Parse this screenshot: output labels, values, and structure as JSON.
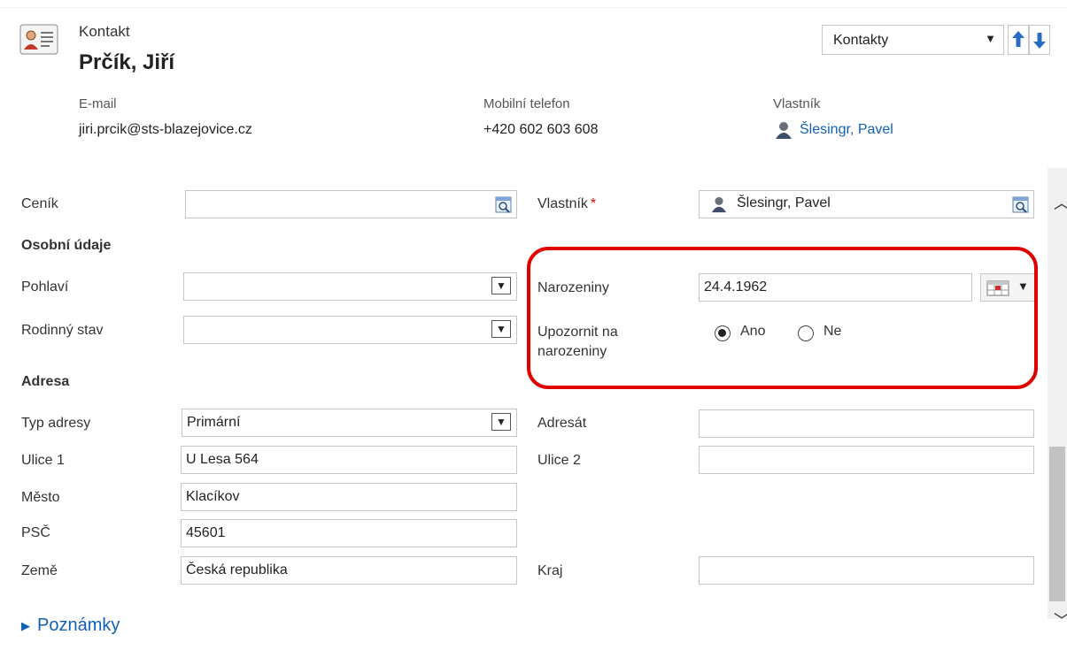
{
  "header": {
    "entity_type": "Kontakt",
    "entity_name": "Prčík, Jiří",
    "view_selector": "Kontakty"
  },
  "summary": {
    "email_label": "E-mail",
    "email_value": "jiri.prcik@sts-blazejovice.cz",
    "mobile_label": "Mobilní telefon",
    "mobile_value": "+420 602 603 608",
    "owner_label": "Vlastník",
    "owner_value": "Šlesingr, Pavel"
  },
  "form": {
    "pricelist_label": "Ceník",
    "pricelist_value": "",
    "owner_label": "Vlastník",
    "owner_required_mark": "*",
    "owner_value": "Šlesingr, Pavel",
    "personal_section": "Osobní údaje",
    "gender_label": "Pohlaví",
    "gender_value": "",
    "marital_label": "Rodinný stav",
    "marital_value": "",
    "birthday_label": "Narozeniny",
    "birthday_value": "24.4.1962",
    "remind_label_1": "Upozornit na",
    "remind_label_2": "narozeniny",
    "remind_yes": "Ano",
    "remind_no": "Ne",
    "remind_selected": "Ano",
    "address_section": "Adresa",
    "address_type_label": "Typ adresy",
    "address_type_value": "Primární",
    "addressee_label": "Adresát",
    "addressee_value": "",
    "street1_label": "Ulice 1",
    "street1_value": "U Lesa 564",
    "street2_label": "Ulice 2",
    "street2_value": "",
    "city_label": "Město",
    "city_value": "Klacíkov",
    "zip_label": "PSČ",
    "zip_value": "45601",
    "country_label": "Země",
    "country_value": "Česká republika",
    "region_label": "Kraj",
    "region_value": ""
  },
  "notes": {
    "label": "Poznámky"
  },
  "colors": {
    "highlight": "#e00000",
    "link": "#1160b7"
  }
}
